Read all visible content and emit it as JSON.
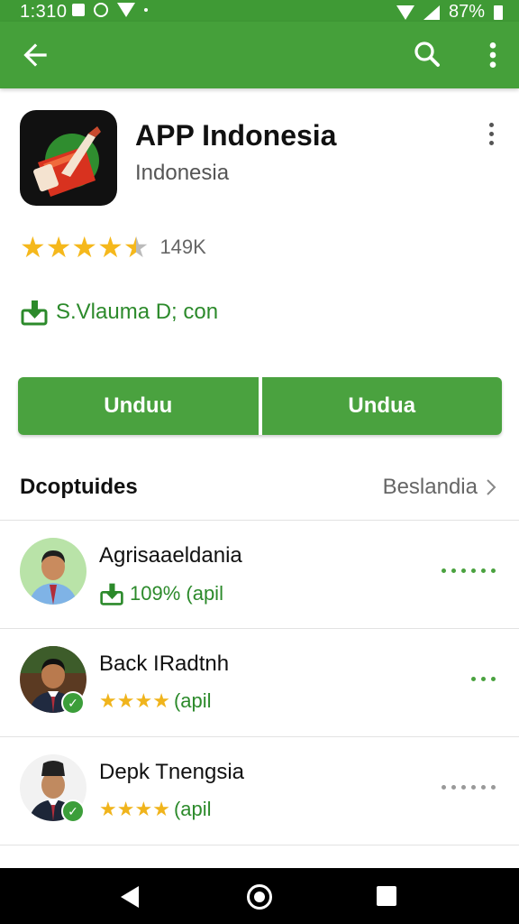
{
  "status_bar": {
    "time": "1:310",
    "battery": "87%"
  },
  "app": {
    "title": "APP Indonesia",
    "subtitle": "Indonesia",
    "rating": 4.5,
    "rating_count": "149K",
    "developer": "S.Vlauma D; con"
  },
  "buttons": {
    "primary": "Unduu",
    "secondary": "Undua"
  },
  "section": {
    "title": "Dcoptuides",
    "more_label": "Beslandia"
  },
  "list": [
    {
      "name": "Agrisaaeldania",
      "meta": "109% (apil",
      "meta_type": "download",
      "dots": 6,
      "dots_color": "green"
    },
    {
      "name": "Back IRadtnh",
      "meta": "(apil",
      "meta_type": "stars",
      "dots": 3,
      "dots_color": "green"
    },
    {
      "name": "Depk Tnengsia",
      "meta": "(apil",
      "meta_type": "stars",
      "dots": 6,
      "dots_color": "gray"
    }
  ],
  "colors": {
    "brand_green": "#45a03a",
    "star_yellow": "#f5b81c"
  }
}
